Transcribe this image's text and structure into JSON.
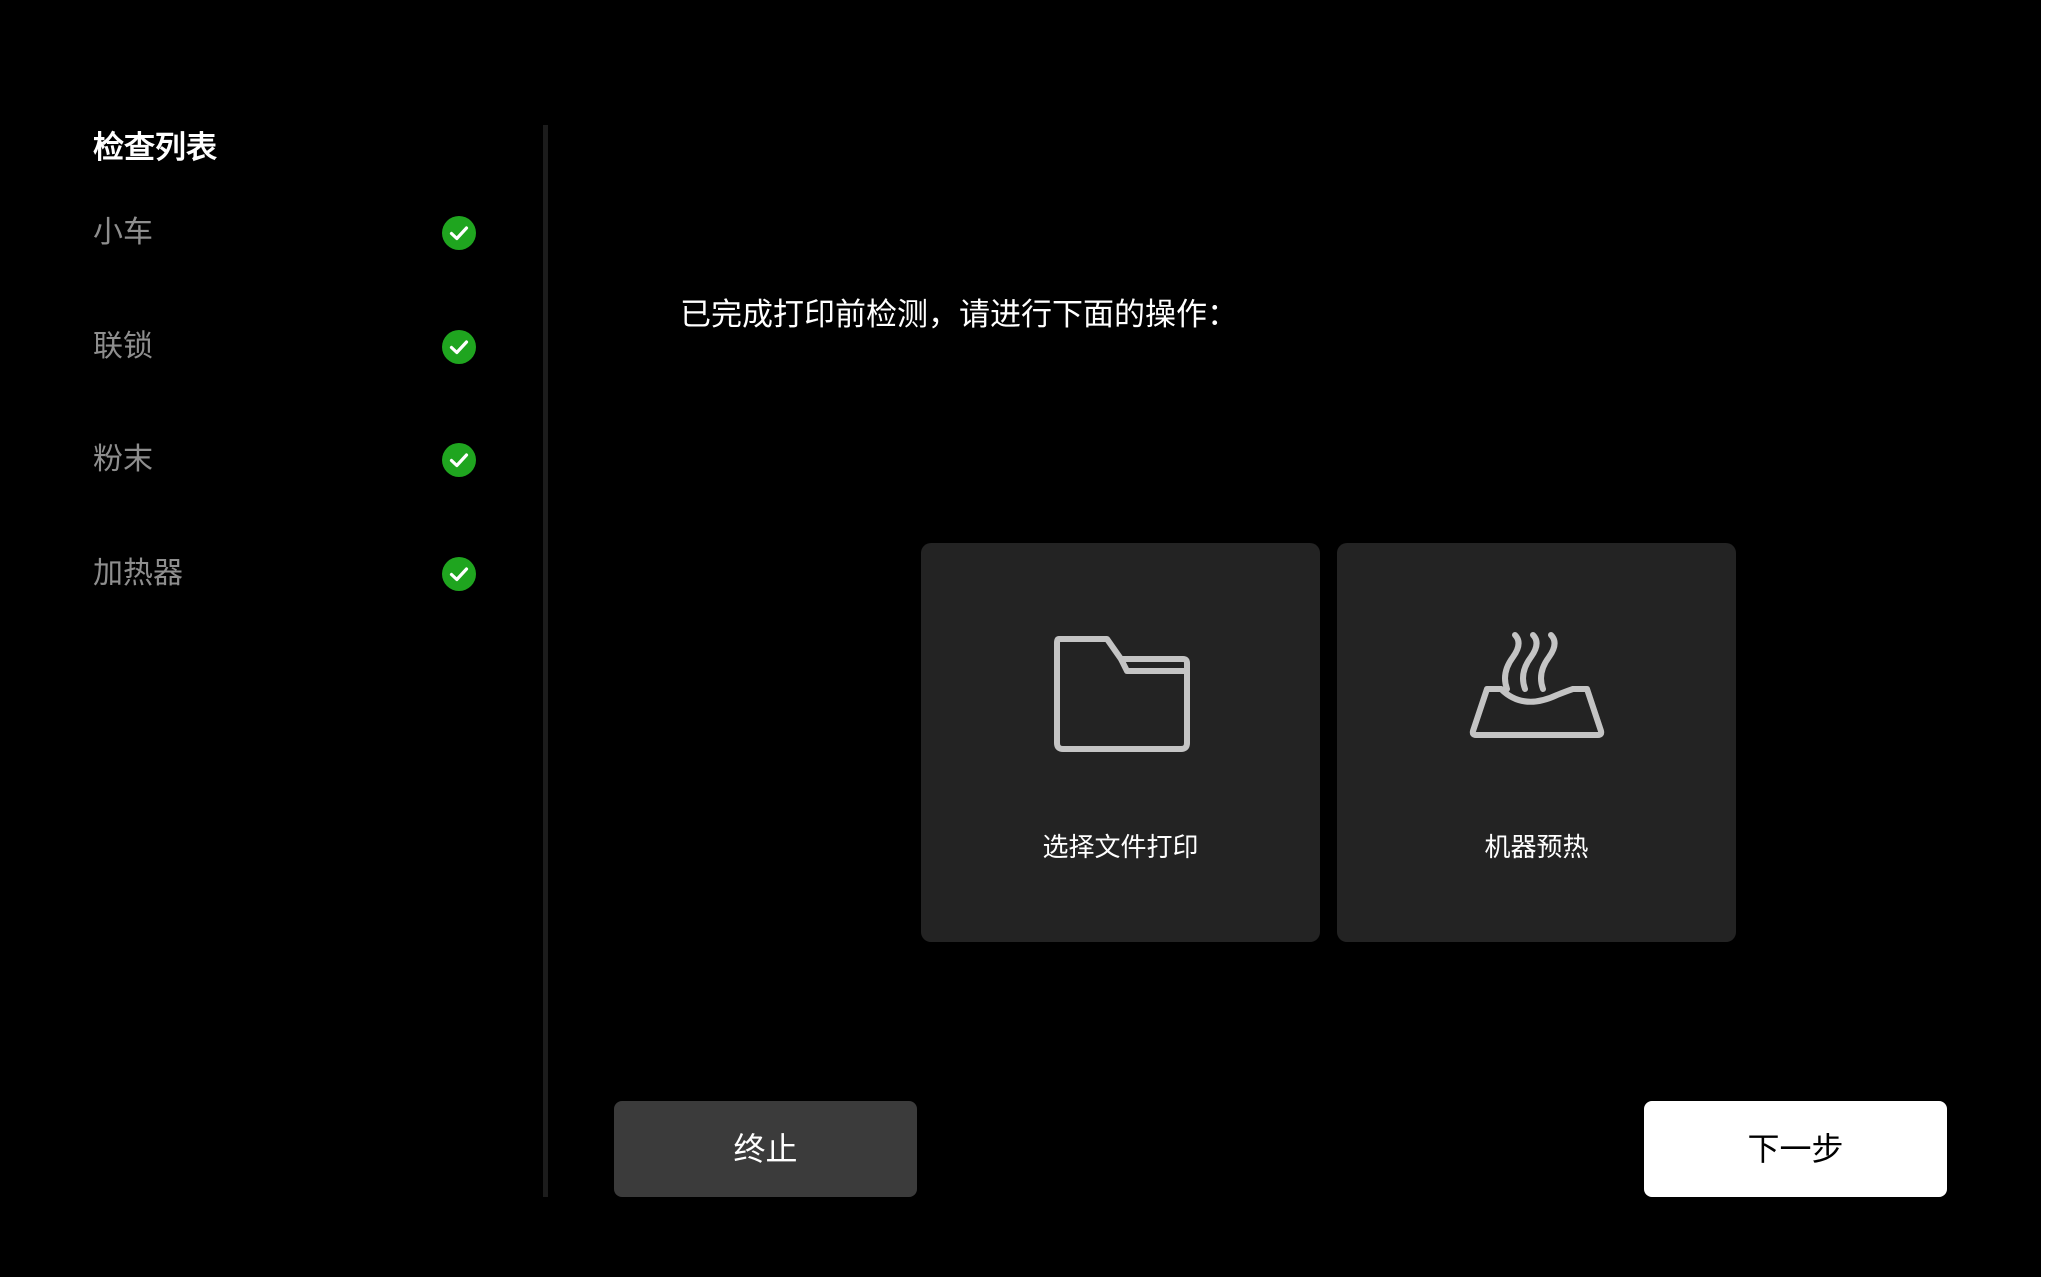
{
  "sidebar": {
    "title": "检查列表",
    "items": [
      {
        "label": "小车",
        "status": "passed",
        "icon": "check-circle-icon"
      },
      {
        "label": "联锁",
        "status": "passed",
        "icon": "check-circle-icon"
      },
      {
        "label": "粉末",
        "status": "passed",
        "icon": "check-circle-icon"
      },
      {
        "label": "加热器",
        "status": "passed",
        "icon": "check-circle-icon"
      }
    ]
  },
  "main": {
    "prompt": "已完成打印前检测，请进行下面的操作：",
    "options": [
      {
        "label": "选择文件打印",
        "icon": "folder-icon"
      },
      {
        "label": "机器预热",
        "icon": "heat-icon"
      }
    ]
  },
  "footer": {
    "stop_label": "终止",
    "next_label": "下一步"
  },
  "colors": {
    "background": "#000000",
    "card": "#232323",
    "check_green": "#1fa51f",
    "muted_text": "#8e8e8e",
    "stop_button": "#3b3b3b",
    "next_button": "#ffffff"
  }
}
